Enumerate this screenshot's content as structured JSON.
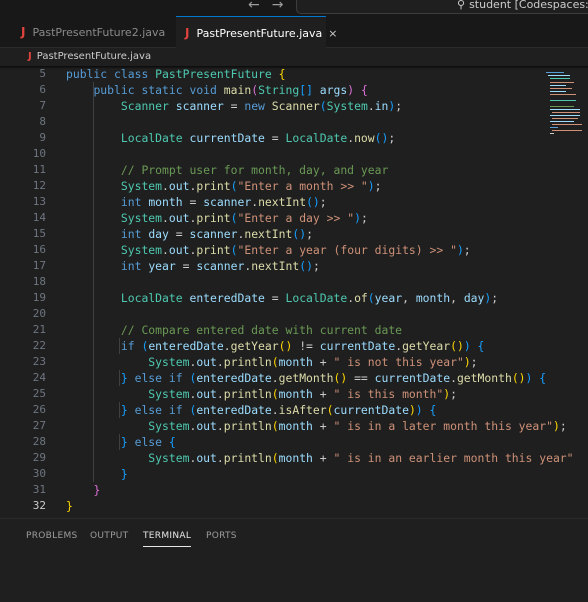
{
  "titlebar": {
    "back_icon": "arrow-left-icon",
    "forward_icon": "arrow-right-icon",
    "command_center_text": "student [Codespaces: litera"
  },
  "tabs": [
    {
      "label": "PastPresentFuture2.java",
      "active": false
    },
    {
      "label": "PastPresentFuture.java",
      "active": true,
      "close": "×"
    }
  ],
  "breadcrumb": {
    "file": "PastPresentFuture.java"
  },
  "editor": {
    "line_numbers": [
      "5",
      "6",
      "7",
      "8",
      "9",
      "10",
      "11",
      "12",
      "13",
      "14",
      "15",
      "16",
      "17",
      "18",
      "19",
      "20",
      "21",
      "22",
      "23",
      "24",
      "25",
      "26",
      "27",
      "28",
      "29",
      "30",
      "31",
      "32"
    ],
    "active_line": "32"
  },
  "panel": {
    "tabs": [
      "PROBLEMS",
      "OUTPUT",
      "TERMINAL",
      "PORTS"
    ],
    "active": "TERMINAL"
  },
  "colors": {
    "editor_bg": "#1f1f1f",
    "keyword": "#569cd6",
    "class": "#4ec9b0",
    "function": "#dcdcaa",
    "variable": "#9cdcfe",
    "string": "#ce9178",
    "comment": "#6a9955",
    "java_icon": "#e0443e"
  }
}
